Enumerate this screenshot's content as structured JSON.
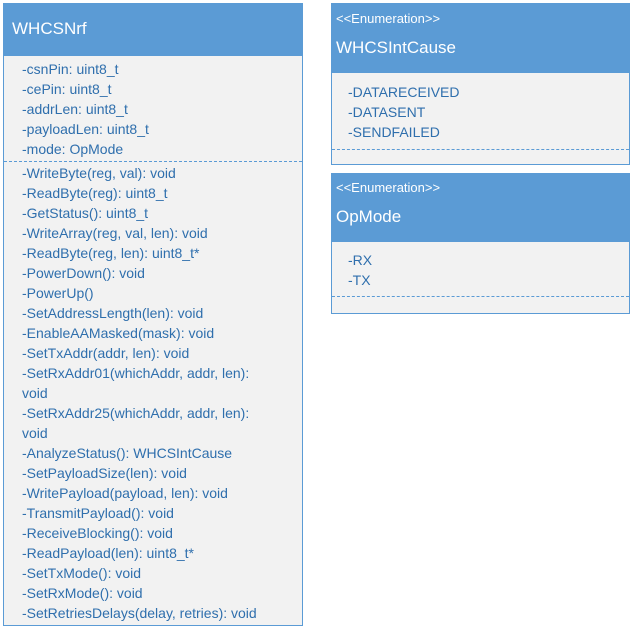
{
  "classes": [
    {
      "name": "WHCSNrf",
      "attributes": [
        "-csnPin: uint8_t",
        "-cePin: uint8_t",
        "-addrLen: uint8_t",
        "-payloadLen: uint8_t",
        "-mode: OpMode"
      ],
      "operations": [
        "-WriteByte(reg, val): void",
        "-ReadByte(reg): uint8_t",
        "-GetStatus(): uint8_t",
        "-WriteArray(reg, val, len): void",
        "-ReadByte(reg, len): uint8_t*",
        "-PowerDown(): void",
        "-PowerUp()",
        "-SetAddressLength(len): void",
        "-EnableAAMasked(mask): void",
        "-SetTxAddr(addr, len): void",
        "-SetRxAddr01(whichAddr, addr, len):",
        "void",
        "-SetRxAddr25(whichAddr, addr, len):",
        "void",
        "-AnalyzeStatus(): WHCSIntCause",
        "-SetPayloadSize(len): void",
        "-WritePayload(payload, len): void",
        "-TransmitPayload(): void",
        "-ReceiveBlocking(): void",
        "-ReadPayload(len): uint8_t*",
        "-SetTxMode(): void",
        "-SetRxMode(): void",
        "-SetRetriesDelays(delay, retries): void"
      ]
    }
  ],
  "enumerations": [
    {
      "stereotype": "<<Enumeration>>",
      "name": "WHCSIntCause",
      "values": [
        "-DATARECEIVED",
        "-DATASENT",
        "-SENDFAILED"
      ]
    },
    {
      "stereotype": "<<Enumeration>>",
      "name": "OpMode",
      "values": [
        "-RX",
        "-TX"
      ]
    }
  ],
  "colors": {
    "header": "#5b9bd5",
    "body": "#f2f2f2",
    "text": "#2f6fad",
    "header_text": "#ffffff"
  }
}
